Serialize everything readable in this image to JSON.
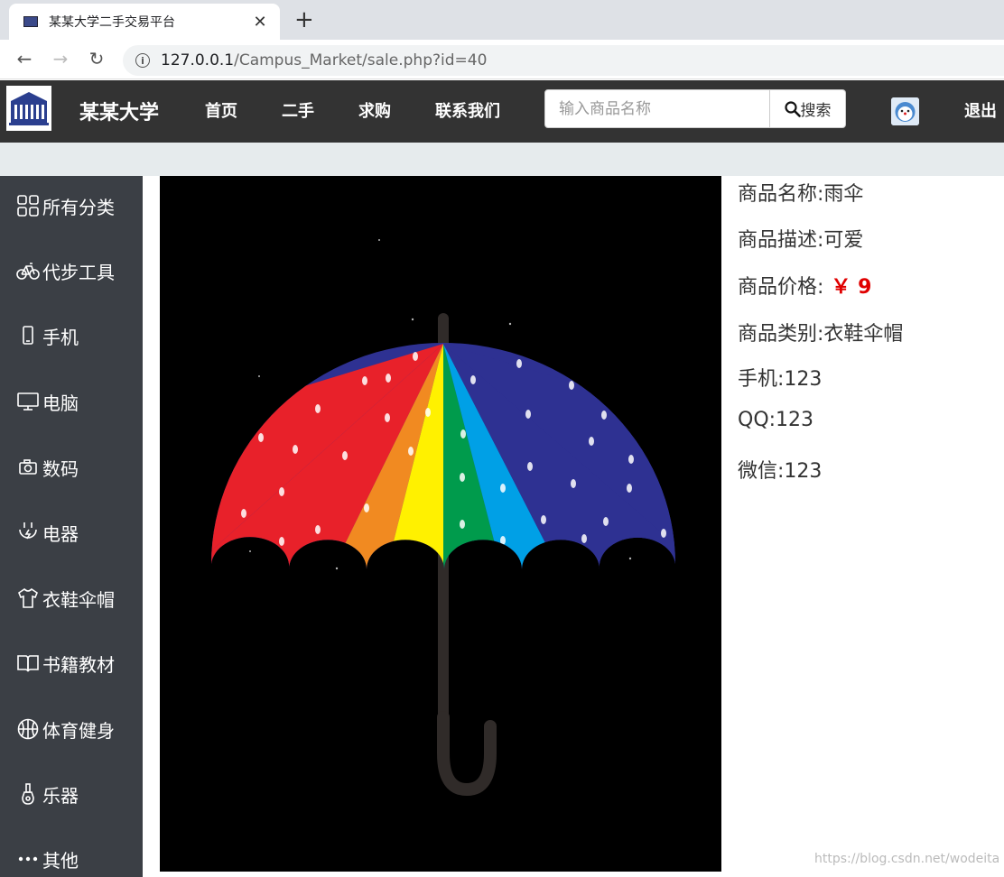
{
  "browser": {
    "tab_title": "某某大学二手交易平台",
    "url_host": "127.0.0.1",
    "url_path": "/Campus_Market/sale.php?id=40"
  },
  "site": {
    "brand": "某某大学",
    "nav": [
      "首页",
      "二手",
      "求购",
      "联系我们"
    ],
    "search_placeholder": "输入商品名称",
    "search_button": "搜索",
    "logout": "退出"
  },
  "sidebar": {
    "items": [
      {
        "label": "所有分类",
        "icon": "grid-icon"
      },
      {
        "label": "代步工具",
        "icon": "bicycle-icon"
      },
      {
        "label": "手机",
        "icon": "phone-icon"
      },
      {
        "label": "电脑",
        "icon": "monitor-icon"
      },
      {
        "label": "数码",
        "icon": "camera-icon"
      },
      {
        "label": "电器",
        "icon": "plug-icon"
      },
      {
        "label": "衣鞋伞帽",
        "icon": "shirt-icon"
      },
      {
        "label": "书籍教材",
        "icon": "book-icon"
      },
      {
        "label": "体育健身",
        "icon": "basketball-icon"
      },
      {
        "label": "乐器",
        "icon": "guitar-icon"
      },
      {
        "label": "其他",
        "icon": "more-icon"
      }
    ]
  },
  "product": {
    "name_line": "商品名称:雨伞",
    "desc_line": "商品描述:可爱",
    "price_label": "商品价格:",
    "price_value": "￥ 9",
    "category_line": "商品类别:衣鞋伞帽",
    "phone_line": "手机:123",
    "qq_line": "QQ:123",
    "wechat_line": "微信:123",
    "image_subject": "rainbow umbrella with raindrops",
    "umbrella_colors": [
      "#e8212a",
      "#f18a21",
      "#fff100",
      "#009b4c",
      "#00a0e6",
      "#2e3192"
    ]
  },
  "watermark": "https://blog.csdn.net/wodeita"
}
